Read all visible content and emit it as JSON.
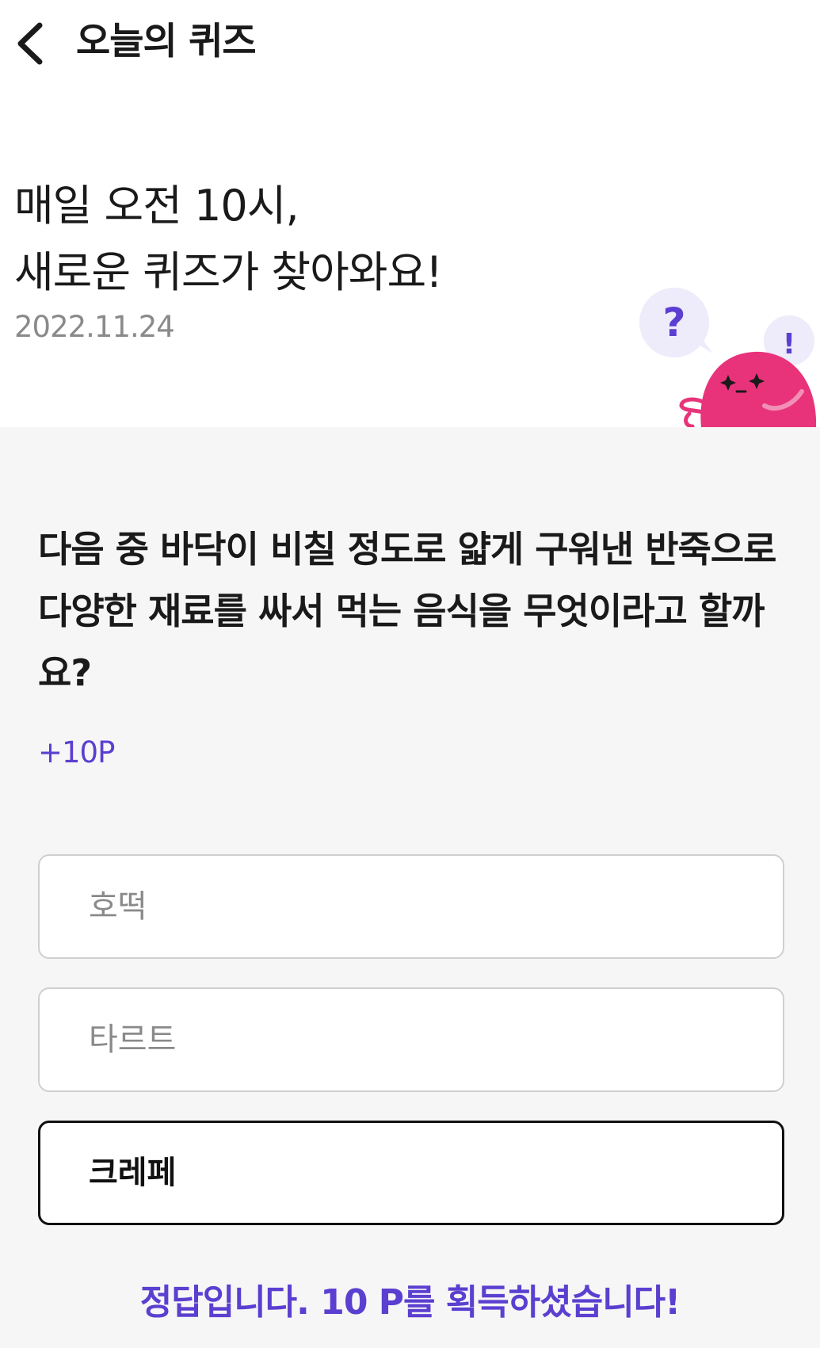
{
  "header": {
    "back_icon": "chevron-left-icon",
    "title": "오늘의 퀴즈"
  },
  "hero": {
    "line1": "매일 오전 10시,",
    "line2": "새로운 퀴즈가 찾아와요!",
    "date": "2022.11.24",
    "bubble_left": "?",
    "bubble_right": "!"
  },
  "quiz": {
    "question": "다음 중 바닥이 비칠 정도로 얇게 구워낸 반죽으로 다양한 재료를 싸서 먹는 음식을 무엇이라고 할까요?",
    "points": "+10P",
    "options": [
      {
        "label": "호떡",
        "selected": false
      },
      {
        "label": "타르트",
        "selected": false
      },
      {
        "label": "크레페",
        "selected": true
      }
    ],
    "result": "정답입니다. 10 P를 획득하셨습니다!"
  },
  "colors": {
    "accent": "#5b3fd0",
    "mascot": "#e8337a",
    "background": "#f6f6f6",
    "bubble": "#eeebfb"
  }
}
